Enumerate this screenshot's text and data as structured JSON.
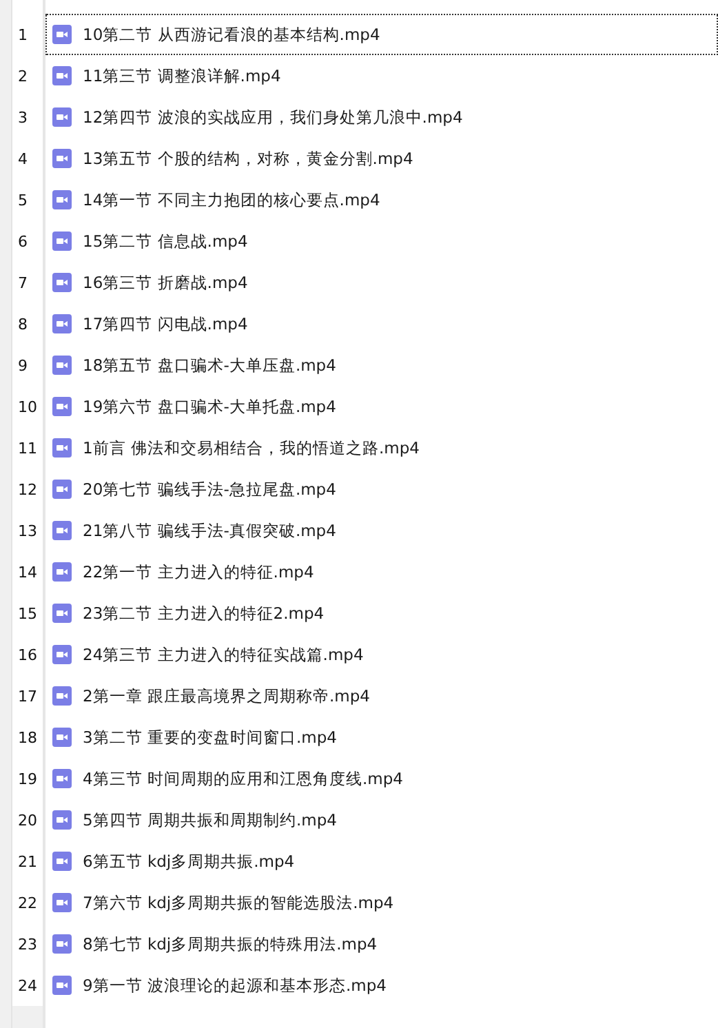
{
  "files": [
    {
      "number": "1",
      "name": "10第二节 从西游记看浪的基本结构.mp4",
      "focused": true
    },
    {
      "number": "2",
      "name": "11第三节 调整浪详解.mp4",
      "focused": false
    },
    {
      "number": "3",
      "name": "12第四节 波浪的实战应用，我们身处第几浪中.mp4",
      "focused": false
    },
    {
      "number": "4",
      "name": "13第五节 个股的结构，对称，黄金分割.mp4",
      "focused": false
    },
    {
      "number": "5",
      "name": "14第一节 不同主力抱团的核心要点.mp4",
      "focused": false
    },
    {
      "number": "6",
      "name": "15第二节 信息战.mp4",
      "focused": false
    },
    {
      "number": "7",
      "name": "16第三节 折磨战.mp4",
      "focused": false
    },
    {
      "number": "8",
      "name": "17第四节 闪电战.mp4",
      "focused": false
    },
    {
      "number": "9",
      "name": "18第五节 盘口骗术-大单压盘.mp4",
      "focused": false
    },
    {
      "number": "10",
      "name": "19第六节 盘口骗术-大单托盘.mp4",
      "focused": false
    },
    {
      "number": "11",
      "name": "1前言 佛法和交易相结合，我的悟道之路.mp4",
      "focused": false
    },
    {
      "number": "12",
      "name": "20第七节 骗线手法-急拉尾盘.mp4",
      "focused": false
    },
    {
      "number": "13",
      "name": "21第八节 骗线手法-真假突破.mp4",
      "focused": false
    },
    {
      "number": "14",
      "name": "22第一节 主力进入的特征.mp4",
      "focused": false
    },
    {
      "number": "15",
      "name": "23第二节 主力进入的特征2.mp4",
      "focused": false
    },
    {
      "number": "16",
      "name": "24第三节 主力进入的特征实战篇.mp4",
      "focused": false
    },
    {
      "number": "17",
      "name": "2第一章 跟庄最高境界之周期称帝.mp4",
      "focused": false
    },
    {
      "number": "18",
      "name": "3第二节 重要的变盘时间窗口.mp4",
      "focused": false
    },
    {
      "number": "19",
      "name": "4第三节 时间周期的应用和江恩角度线.mp4",
      "focused": false
    },
    {
      "number": "20",
      "name": "5第四节 周期共振和周期制约.mp4",
      "focused": false
    },
    {
      "number": "21",
      "name": "6第五节 kdj多周期共振.mp4",
      "focused": false
    },
    {
      "number": "22",
      "name": "7第六节 kdj多周期共振的智能选股法.mp4",
      "focused": false
    },
    {
      "number": "23",
      "name": "8第七节 kdj多周期共振的特殊用法.mp4",
      "focused": false
    },
    {
      "number": "24",
      "name": "9第一节 波浪理论的起源和基本形态.mp4",
      "focused": false
    }
  ]
}
